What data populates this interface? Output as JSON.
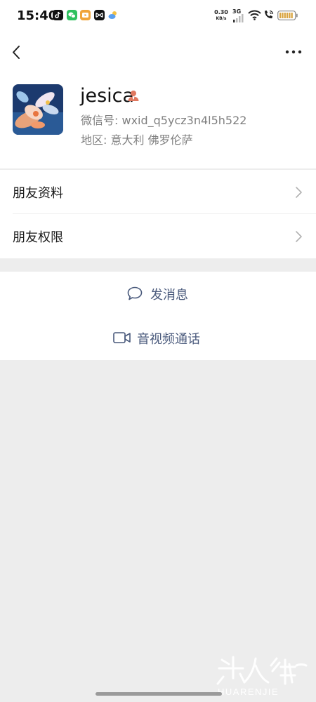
{
  "status_bar": {
    "time": "15:40",
    "net_speed_value": "0.30",
    "net_speed_unit": "KB/s",
    "net_type": "3G",
    "app_icons": [
      "douyin-icon",
      "wechat-icon",
      "video-app-icon",
      "capcut-icon",
      "weather-icon"
    ],
    "signal_icon": "signal-icon",
    "wifi_icon": "wifi-icon",
    "call_icon": "wifi-call-icon",
    "battery_icon": "battery-icon"
  },
  "nav": {
    "back_icon": "chevron-left-icon",
    "more_icon": "more-dots-icon"
  },
  "profile": {
    "name": "jesica",
    "gender_icon": "person-icon",
    "wechat_id": "微信号:  wxid_q5ycz3n4l5h522",
    "region": "地区:  意大利  佛罗伦萨"
  },
  "menu": [
    {
      "label": "朋友资料",
      "icon": "chevron-right-icon"
    },
    {
      "label": "朋友权限",
      "icon": "chevron-right-icon"
    }
  ],
  "actions": {
    "message": {
      "label": "发消息",
      "icon": "chat-bubble-icon"
    },
    "video_call": {
      "label": "音视频通话",
      "icon": "video-camera-icon"
    }
  },
  "watermark": {
    "subtext": "HUARENJIE"
  },
  "colors": {
    "background": "#ededed",
    "panel": "#ffffff",
    "action_text": "#4a5a7c",
    "secondary_text": "#7f7f7f",
    "person_icon": "#e0785f"
  }
}
